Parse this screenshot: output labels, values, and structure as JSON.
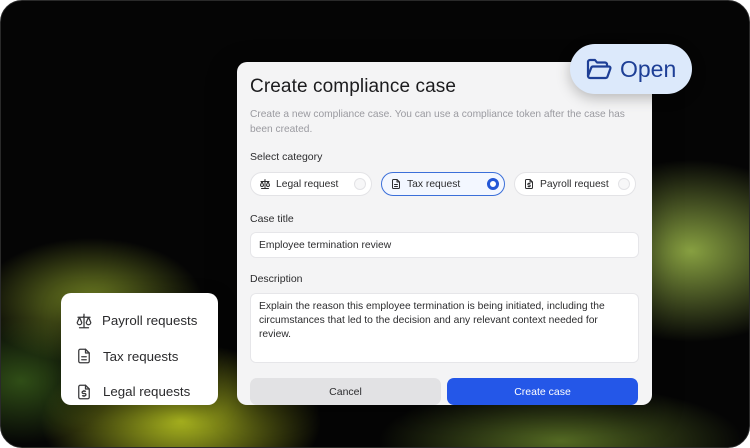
{
  "modal": {
    "title": "Create compliance case",
    "description": "Create a new compliance case. You can use a compliance token after the case has been created.",
    "category_label": "Select category",
    "categories": [
      {
        "label": "Legal request",
        "icon": "scale-icon",
        "selected": false
      },
      {
        "label": "Tax request",
        "icon": "document-icon",
        "selected": true
      },
      {
        "label": "Payroll request",
        "icon": "dollar-document-icon",
        "selected": false
      }
    ],
    "case_title_label": "Case title",
    "case_title_value": "Employee termination review",
    "description_label": "Description",
    "description_value": "Explain the reason this employee termination is being initiated, including the circumstances that led to the decision and any relevant context needed for review.",
    "cancel_label": "Cancel",
    "create_label": "Create case"
  },
  "open_pill": {
    "label": "Open",
    "icon": "folder-open-icon"
  },
  "requests_card": {
    "items": [
      {
        "label": "Payroll requests",
        "icon": "scale-icon"
      },
      {
        "label": "Tax requests",
        "icon": "document-icon"
      },
      {
        "label": "Legal requests",
        "icon": "dollar-document-icon"
      }
    ]
  },
  "colors": {
    "accent": "#2457e8",
    "pill_bg": "#dce9fb",
    "pill_text": "#1e3f96",
    "modal_bg": "#f4f4f5"
  }
}
